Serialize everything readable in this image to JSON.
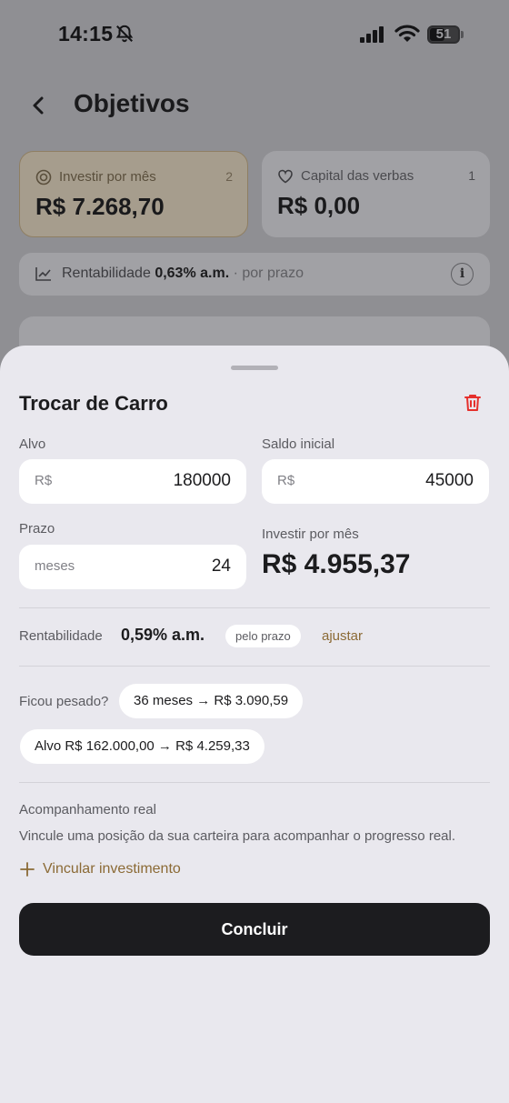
{
  "status_bar": {
    "time": "14:15",
    "battery_level": "51"
  },
  "header": {
    "title": "Objetivos"
  },
  "summary_cards": [
    {
      "label": "Investir por mês",
      "count": "2",
      "value": "R$ 7.268,70",
      "icon": "target-icon"
    },
    {
      "label": "Capital das verbas",
      "count": "1",
      "value": "R$ 0,00",
      "icon": "heart-icon"
    }
  ],
  "rentability_banner": {
    "prefix": "Rentabilidade",
    "value": "0,63% a.m.",
    "suffix": "· por prazo"
  },
  "sheet": {
    "title": "Trocar de Carro",
    "target": {
      "label": "Alvo",
      "prefix": "R$",
      "value": "180000"
    },
    "initial_balance": {
      "label": "Saldo inicial",
      "prefix": "R$",
      "value": "45000"
    },
    "term": {
      "label": "Prazo",
      "prefix": "meses",
      "value": "24"
    },
    "monthly": {
      "label": "Investir por mês",
      "value": "R$ 4.955,37"
    },
    "rentability": {
      "label": "Rentabilidade",
      "value": "0,59% a.m.",
      "chip": "pelo prazo",
      "adjust": "ajustar"
    },
    "heavy": {
      "label": "Ficou pesado?",
      "option_term": "36 meses → R$ 3.090,59",
      "option_target": "Alvo R$ 162.000,00 → R$ 4.259,33"
    },
    "tracking": {
      "title": "Acompanhamento real",
      "description": "Vincule uma posição da sua carteira para acompanhar o progresso real.",
      "link": "Vincular investimento"
    },
    "primary_button": "Concluir"
  },
  "colors": {
    "accent_gold": "#8b6a35",
    "danger": "#e5302c",
    "button_dark": "#1c1c1f",
    "sheet_bg": "#e9e8ee"
  }
}
